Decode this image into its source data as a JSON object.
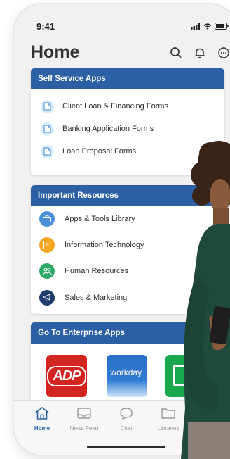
{
  "status_bar": {
    "time": "9:41"
  },
  "header": {
    "title": "Home"
  },
  "self_service": {
    "title": "Self Service Apps",
    "items": [
      {
        "label": "Client Loan & Financing Forms"
      },
      {
        "label": "Banking Application Forms"
      },
      {
        "label": "Loan Proposal Forms"
      }
    ]
  },
  "resources": {
    "title": "Important Resources",
    "items": [
      {
        "label": "Apps & Tools Library",
        "icon": "briefcase-icon",
        "color": "#4a90d9"
      },
      {
        "label": "Information Technology",
        "icon": "monitor-icon",
        "color": "#f5a623"
      },
      {
        "label": "Human Resources",
        "icon": "people-icon",
        "color": "#2ea86a"
      },
      {
        "label": "Sales & Marketing",
        "icon": "megaphone-icon",
        "color": "#1f3c6e"
      }
    ]
  },
  "enterprise": {
    "title": "Go To Enterprise Apps",
    "apps": [
      {
        "label": "ADP",
        "color": "#d3251f"
      },
      {
        "label": "workday.",
        "color": "#2a6fc5"
      },
      {
        "color": "#1aa84e"
      }
    ]
  },
  "tabs": [
    {
      "label": "Home",
      "active": true
    },
    {
      "label": "News Feed"
    },
    {
      "label": "Chat"
    },
    {
      "label": "Libraries"
    }
  ],
  "colors": {
    "accent": "#2b61a4",
    "background": "#f1f1f1"
  }
}
